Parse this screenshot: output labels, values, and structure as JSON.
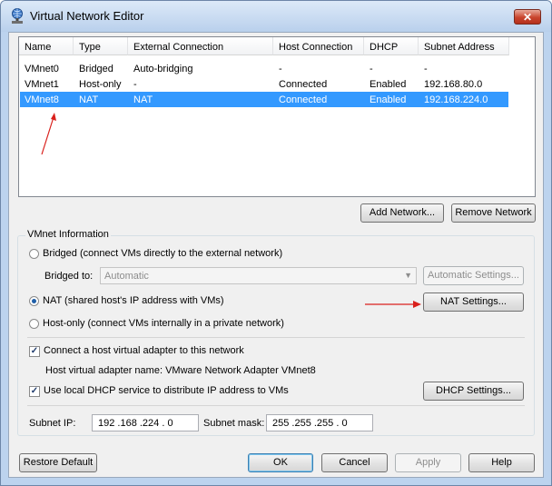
{
  "window": {
    "title": "Virtual Network Editor",
    "close_label": "✕"
  },
  "table": {
    "columns": [
      "Name",
      "Type",
      "External Connection",
      "Host Connection",
      "DHCP",
      "Subnet Address"
    ],
    "rows": [
      [
        "VMnet0",
        "Bridged",
        "Auto-bridging",
        "-",
        "-",
        "-"
      ],
      [
        "VMnet1",
        "Host-only",
        "-",
        "Connected",
        "Enabled",
        "192.168.80.0"
      ],
      [
        "VMnet8",
        "NAT",
        "NAT",
        "Connected",
        "Enabled",
        "192.168.224.0"
      ]
    ],
    "selected_row": 2
  },
  "list_buttons": {
    "add_network": "Add Network...",
    "remove_network": "Remove Network"
  },
  "vmnet_info": {
    "label": "VMnet Information",
    "bridged_label": "Bridged (connect VMs directly to the external network)",
    "bridged_to_label": "Bridged to:",
    "bridged_to_value": "Automatic",
    "automatic_settings": "Automatic Settings...",
    "nat_label": "NAT (shared host's IP address with VMs)",
    "nat_settings": "NAT Settings...",
    "hostonly_label": "Host-only (connect VMs internally in a private network)",
    "selected_mode": "NAT",
    "connect_adapter_label": "Connect a host virtual adapter to this network",
    "connect_adapter_checked": true,
    "adapter_name_label": "Host virtual adapter name: VMware Network Adapter VMnet8",
    "dhcp_label": "Use local DHCP service to distribute IP address to VMs",
    "dhcp_checked": true,
    "dhcp_settings": "DHCP Settings...",
    "subnet_ip_label": "Subnet IP:",
    "subnet_ip_value": "192 .168 .224 . 0",
    "subnet_mask_label": "Subnet mask:",
    "subnet_mask_value": "255 .255 .255 . 0"
  },
  "footer": {
    "restore_default": "Restore Default",
    "ok": "OK",
    "cancel": "Cancel",
    "apply": "Apply",
    "help": "Help"
  },
  "colors": {
    "selection": "#3399ff",
    "annotation_arrow": "#d9201c",
    "title_bar": "#bcd3ee"
  },
  "icons": {
    "app": "network-globe-icon",
    "close": "close-icon",
    "dropdown": "chevron-down-icon"
  }
}
